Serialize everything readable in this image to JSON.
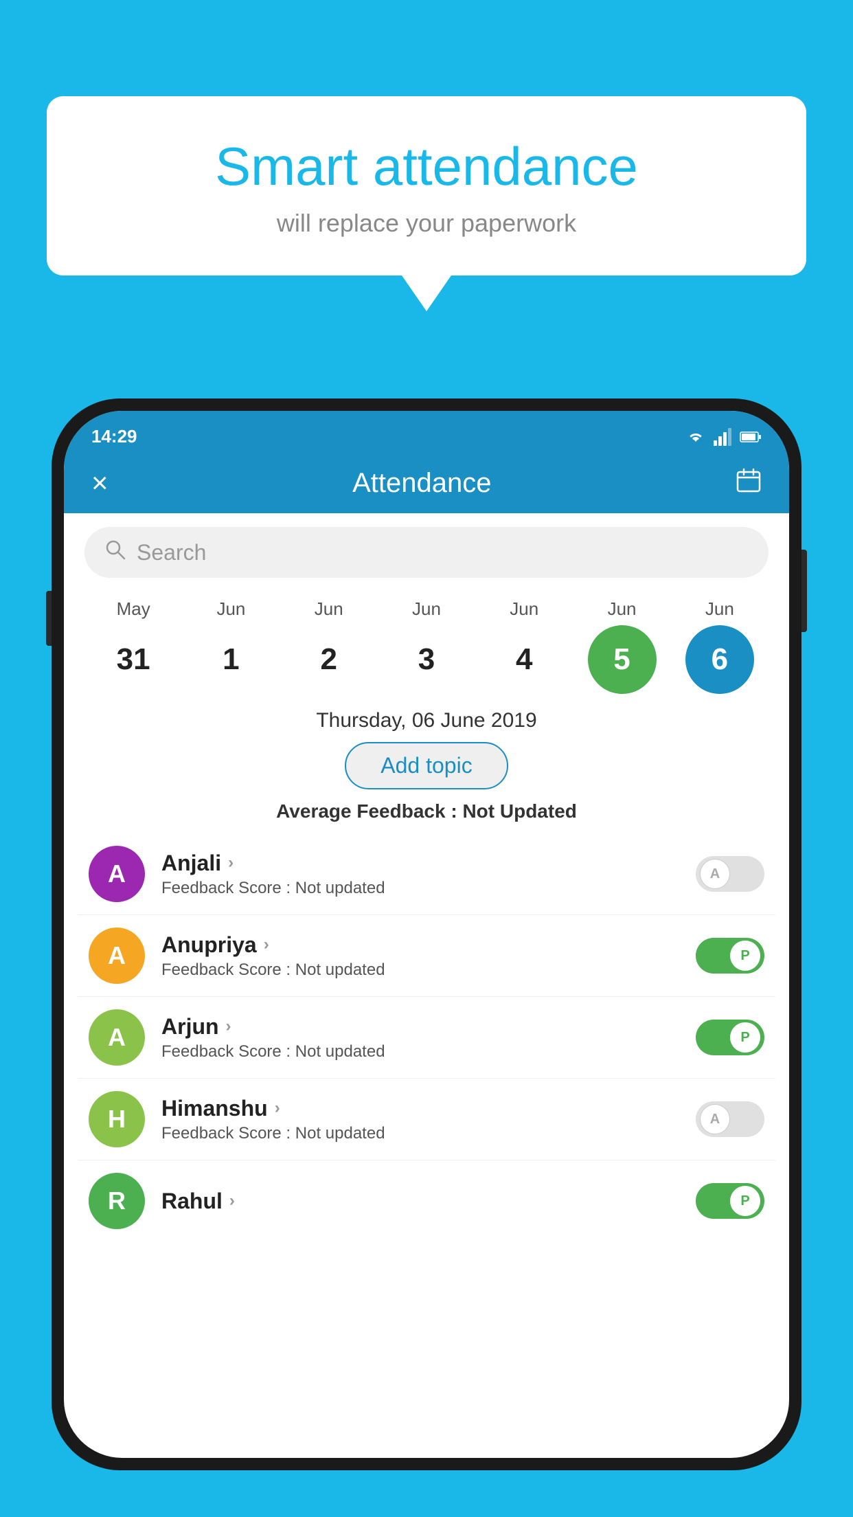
{
  "background_color": "#1ab8e8",
  "speech_bubble": {
    "title": "Smart attendance",
    "subtitle": "will replace your paperwork"
  },
  "status_bar": {
    "time": "14:29"
  },
  "app_header": {
    "title": "Attendance",
    "close_label": "×",
    "calendar_icon": "calendar-icon"
  },
  "search": {
    "placeholder": "Search"
  },
  "calendar": {
    "months": [
      "May",
      "Jun",
      "Jun",
      "Jun",
      "Jun",
      "Jun",
      "Jun"
    ],
    "days": [
      "31",
      "1",
      "2",
      "3",
      "4",
      "5",
      "6"
    ],
    "selected_date_label": "Thursday, 06 June 2019",
    "today_green_index": 5,
    "today_blue_index": 6
  },
  "add_topic_btn": "Add topic",
  "avg_feedback": {
    "label": "Average Feedback : ",
    "value": "Not Updated"
  },
  "students": [
    {
      "name": "Anjali",
      "initial": "A",
      "avatar_color": "#9c27b0",
      "feedback_label": "Feedback Score : ",
      "feedback_value": "Not updated",
      "attendance": "absent"
    },
    {
      "name": "Anupriya",
      "initial": "A",
      "avatar_color": "#f5a623",
      "feedback_label": "Feedback Score : ",
      "feedback_value": "Not updated",
      "attendance": "present"
    },
    {
      "name": "Arjun",
      "initial": "A",
      "avatar_color": "#8bc34a",
      "feedback_label": "Feedback Score : ",
      "feedback_value": "Not updated",
      "attendance": "present"
    },
    {
      "name": "Himanshu",
      "initial": "H",
      "avatar_color": "#8bc34a",
      "feedback_label": "Feedback Score : ",
      "feedback_value": "Not updated",
      "attendance": "absent"
    }
  ]
}
